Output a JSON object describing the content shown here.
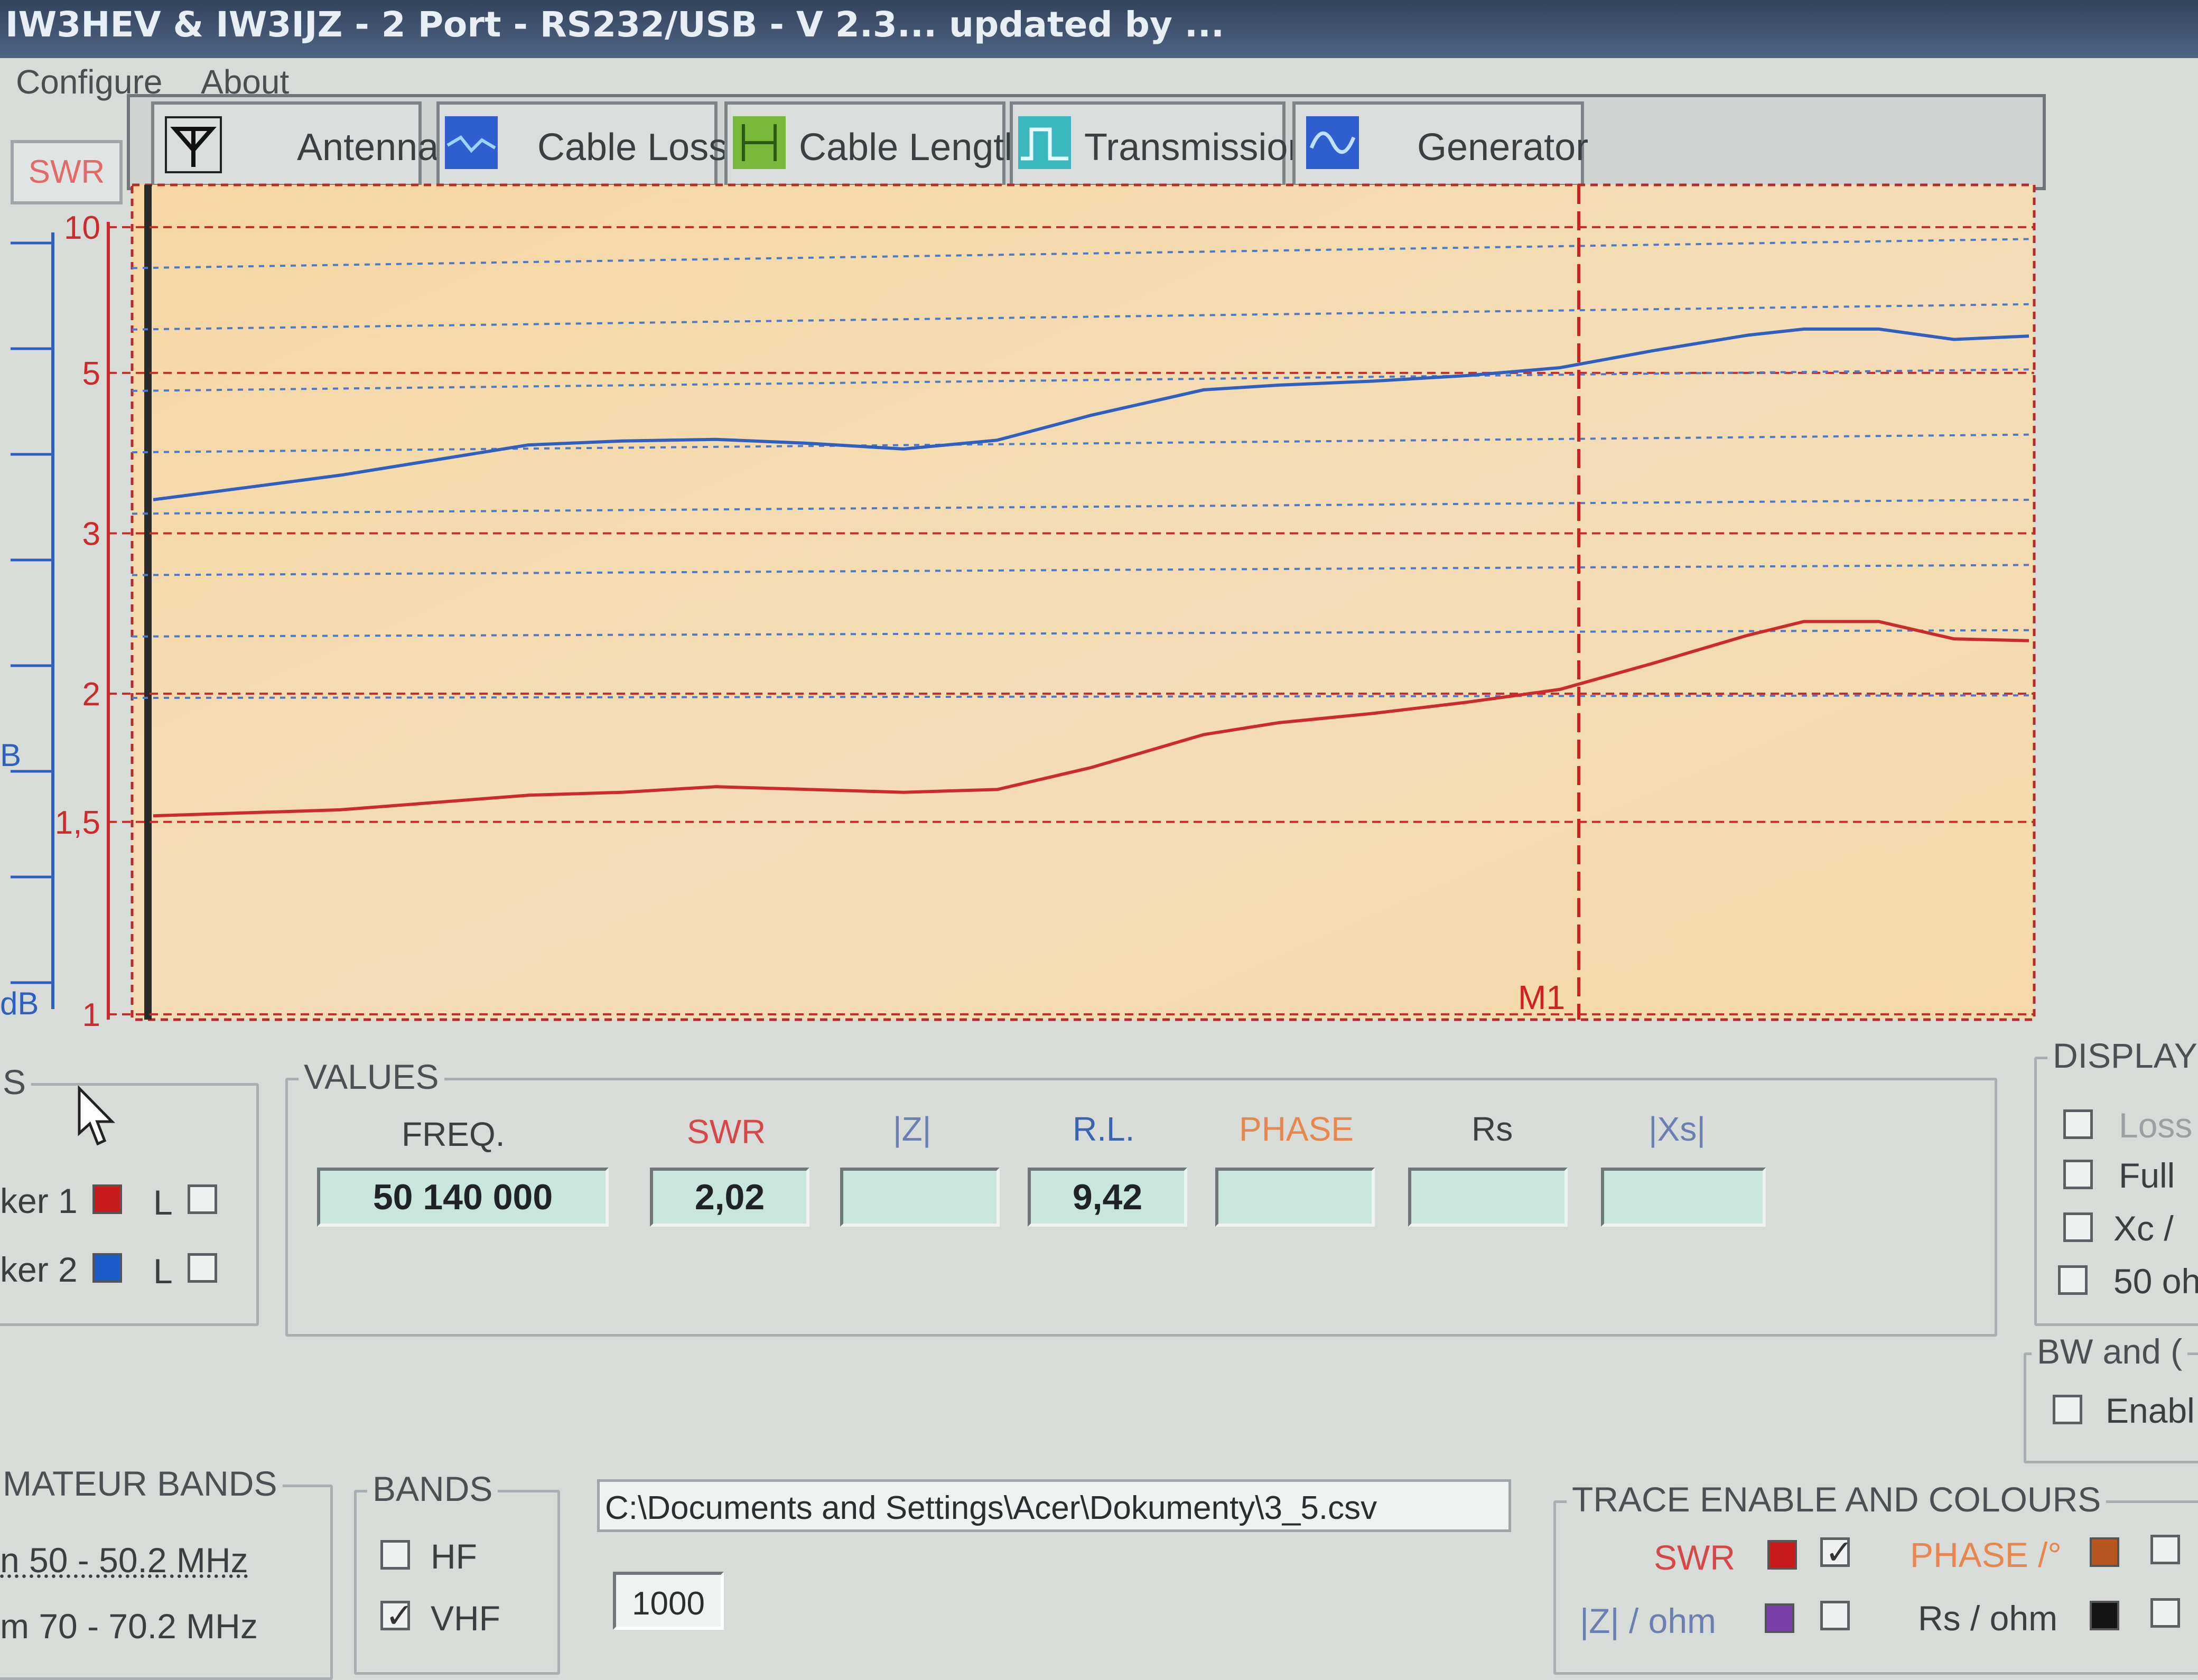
{
  "window": {
    "title": "IW3HEV & IW3IJZ - 2 Port - RS232/USB - V 2.3... updated by ..."
  },
  "menu": {
    "configure": "Configure",
    "about": "About"
  },
  "swr_button": "SWR",
  "tabs": [
    {
      "label": "Antenna",
      "icon": "antenna-icon"
    },
    {
      "label": "Cable Loss",
      "icon": "cable-loss-icon"
    },
    {
      "label": "Cable Length",
      "icon": "cable-length-icon"
    },
    {
      "label": "Transmission",
      "icon": "transmission-icon"
    },
    {
      "label": "Generator",
      "icon": "generator-icon"
    }
  ],
  "chart": {
    "left_axis_label_top": "10",
    "db_label": "B",
    "db_label_bottom": "dB",
    "marker_label": "M1"
  },
  "chart_data": {
    "type": "line",
    "y_axis_scale": "swr (non-linear)",
    "ylim": [
      1,
      10
    ],
    "y_ticks": [
      "10",
      "5",
      "3",
      "2",
      "1,5",
      "1"
    ],
    "x_domain": [
      0,
      100
    ],
    "marker_x": 76,
    "series": [
      {
        "color": "#cc2b2b",
        "x": [
          0,
          10,
          20,
          25,
          30,
          35,
          40,
          45,
          50,
          56,
          60,
          65,
          70,
          75,
          80,
          85,
          88,
          92,
          96,
          100
        ],
        "y": [
          1.52,
          1.54,
          1.59,
          1.6,
          1.62,
          1.61,
          1.6,
          1.61,
          1.69,
          1.82,
          1.87,
          1.91,
          1.96,
          2.02,
          2.15,
          2.3,
          2.38,
          2.38,
          2.28,
          2.27
        ]
      },
      {
        "color": "#2f5fbf",
        "x": [
          0,
          10,
          20,
          25,
          30,
          35,
          40,
          45,
          50,
          56,
          60,
          65,
          70,
          75,
          80,
          85,
          88,
          92,
          96,
          100
        ],
        "y": [
          3.3,
          3.55,
          3.9,
          3.95,
          3.97,
          3.92,
          3.85,
          3.96,
          4.3,
          4.7,
          4.78,
          4.85,
          4.95,
          5.1,
          5.45,
          5.8,
          5.95,
          5.95,
          5.7,
          5.78
        ]
      }
    ]
  },
  "markers_group": {
    "title": "S",
    "marker1": "ker 1",
    "marker2": "ker 2",
    "l": "L",
    "marker1_color": "#c81c1c",
    "marker2_color": "#1b5cc8"
  },
  "values": {
    "title": "VALUES",
    "headers": {
      "freq": "FREQ.",
      "swr": "SWR",
      "z": "|Z|",
      "rl": "R.L.",
      "phase": "PHASE",
      "rs": "Rs",
      "xs": "|Xs|"
    },
    "freq": "50 140 000",
    "swr": "2,02",
    "z": "",
    "rl": "9,42",
    "phase": "",
    "rs": "",
    "xs": ""
  },
  "display_group": {
    "title": "DISPLAY",
    "loss": "Loss",
    "full": "Full",
    "xc": "Xc /",
    "ohm50": "50 oh"
  },
  "bw_group": {
    "title": "BW and (",
    "enable": "Enabl"
  },
  "amateur_bands": {
    "title": "MATEUR BANDS",
    "band1": "n 50 - 50.2 MHz",
    "band2": "m 70 - 70.2 MHz"
  },
  "bands": {
    "title": "BANDS",
    "hf": "HF",
    "vhf": "VHF",
    "hf_checked": false,
    "vhf_checked": true
  },
  "file_path": "C:\\Documents and Settings\\Acer\\Dokumenty\\3_5.csv",
  "steps": "1000",
  "trace_group": {
    "title": "TRACE ENABLE AND COLOURS",
    "swr": "SWR",
    "phase": "PHASE /°",
    "z": "|Z| / ohm",
    "rs": "Rs / ohm",
    "swr_color": "#c81c1c",
    "phase_color": "#b9561f",
    "z_color": "#7a3fa8",
    "rs_color": "#151515"
  }
}
